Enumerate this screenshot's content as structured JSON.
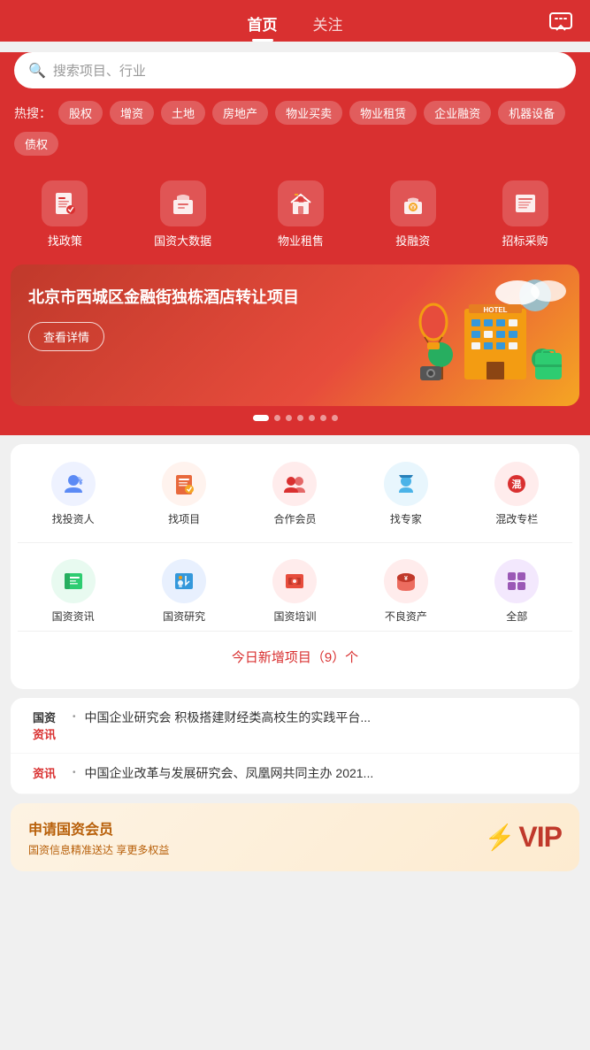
{
  "header": {
    "tab_home": "首页",
    "tab_follow": "关注",
    "msg_icon": "💬"
  },
  "search": {
    "placeholder": "搜索项目、行业"
  },
  "hot_search": {
    "label": "热搜：",
    "tags": [
      "股权",
      "增资",
      "土地",
      "房地产",
      "物业买卖",
      "物业租赁",
      "企业融资",
      "机器设备",
      "债权"
    ]
  },
  "nav_icons": [
    {
      "label": "找政策",
      "icon": "📋"
    },
    {
      "label": "国资大数据",
      "icon": "🏠"
    },
    {
      "label": "物业租售",
      "icon": "🏷️"
    },
    {
      "label": "投融资",
      "icon": "🏦"
    },
    {
      "label": "招标采购",
      "icon": "📄"
    }
  ],
  "banner": {
    "title": "北京市西城区金融街独栋酒店转让项目",
    "button": "查看详情",
    "dots": [
      true,
      false,
      false,
      false,
      false,
      false,
      false
    ]
  },
  "services_row1": [
    {
      "label": "找投资人",
      "icon": "👤",
      "color": "#5b8af5"
    },
    {
      "label": "找项目",
      "icon": "📁",
      "color": "#e8693c"
    },
    {
      "label": "合作会员",
      "icon": "👥",
      "color": "#d93030"
    },
    {
      "label": "找专家",
      "icon": "🎓",
      "color": "#4ab3e8"
    },
    {
      "label": "混改专栏",
      "icon": "🔴",
      "color": "#d93030"
    }
  ],
  "services_row2": [
    {
      "label": "国资资讯",
      "icon": "📰",
      "color": "#2ecc71"
    },
    {
      "label": "国资研究",
      "icon": "📊",
      "color": "#3498db"
    },
    {
      "label": "国资培训",
      "icon": "🎭",
      "color": "#e74c3c"
    },
    {
      "label": "不良资产",
      "icon": "🗄️",
      "color": "#e74c3c"
    },
    {
      "label": "全部",
      "icon": "⚙️",
      "color": "#9b59b6"
    }
  ],
  "today_new": "今日新增项目（9）个",
  "news": [
    {
      "badge_top": "国资",
      "badge_bottom": "",
      "dot": "•",
      "text": "中国企业研究会 积极搭建财经类高校生的实践平台..."
    },
    {
      "badge_top": "",
      "badge_bottom": "资讯",
      "dot": "•",
      "text": "中国企业改革与发展研究会、凤凰网共同主办 2021..."
    }
  ],
  "vip": {
    "title": "申请国资会员",
    "subtitle": "国资信息精准送达 享更多权益",
    "vip_label": "VIP"
  }
}
